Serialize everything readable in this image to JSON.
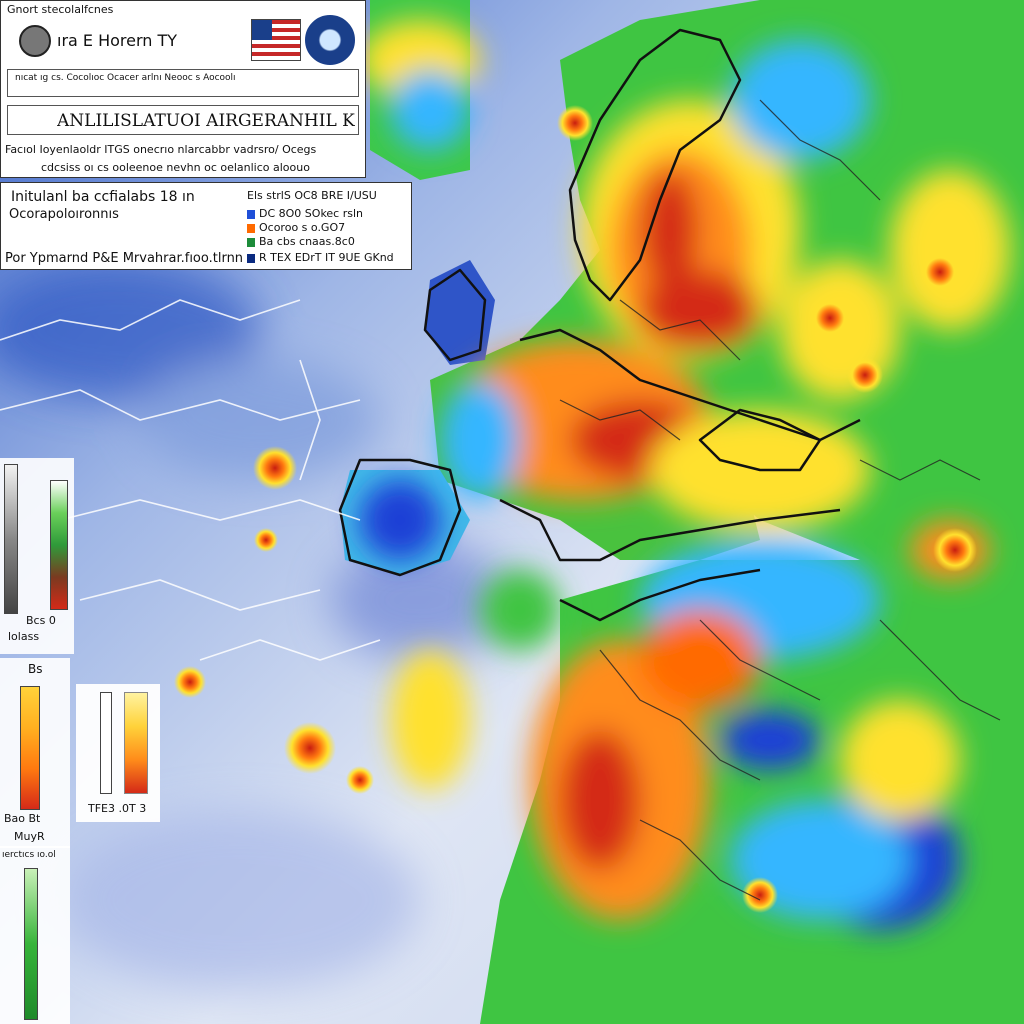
{
  "header": {
    "top_label": "Gnort stecolalfcnes",
    "agency_name": "ıra E Horern TY",
    "fine_print": "nıcat ıg cs. Cocolıoc Ocacer arlnı Neooc s Aocoolı ",
    "main_title": "ANLILISLATUOI AIRGERANHIL K",
    "sub_line_1": "Facıol Ioyenlaoldr ITGS onecrıo nlarcabbr vadrsro/ Ocegs",
    "sub_line_2": "cdcsiss oı cs ooleenoe nevhn oc oelanlico aloouo"
  },
  "info_panel": {
    "line_1": "Initulanl ba ccfialabs 18 ın",
    "line_2": "Ocorapoloıronnıs",
    "line_3": "Por Ypmarnd P&E Mrvahrar.fıoo.tlrnn",
    "legend_title": "Els strlS OC8 BRE I/USU",
    "legend_items": [
      {
        "label": "DC 8O0 SOkec rsln",
        "color": "#1f4fd8"
      },
      {
        "label": "Ocoroo s o.GO7",
        "color": "#ff6a00"
      },
      {
        "label": "Ba cbs cnaas.8c0",
        "color": "#1d8c3a"
      },
      {
        "label": "R TEX EDrT IT 9UE GKnd",
        "color": "#0a2a80"
      }
    ]
  },
  "left_legends": {
    "label_a": "Bcs 0",
    "label_b": "lolass",
    "label_c": "Bs",
    "label_d": "TFE3 .0T 3",
    "label_e": "Bao Bt",
    "label_f": "MuyR",
    "label_g": "ıerctıcs ıo.ol"
  },
  "colors": {
    "ocean_base": "#dbe4f2",
    "land_base": "#3fc542",
    "hot": "#d42a18",
    "warm": "#ff8c1a",
    "mild": "#ffe12e",
    "cool": "#35b6ff",
    "cold": "#1f3fd6",
    "outline": "#111111"
  },
  "icons": [
    "emblem-icon",
    "us-flag-icon",
    "seal-icon"
  ]
}
